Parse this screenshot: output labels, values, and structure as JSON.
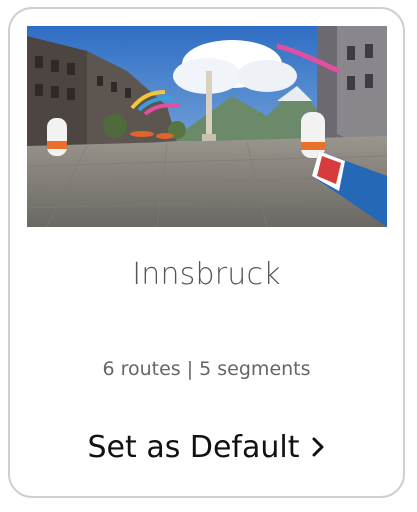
{
  "card": {
    "title": "Innsbruck",
    "stats": "6 routes | 5 segments",
    "action_label": "Set as Default",
    "thumbnail_icon": "innsbruck-street-scene-image",
    "chevron_icon": "chevron-right-icon"
  },
  "colors": {
    "border": "#cfcfcf",
    "title": "#555555",
    "stats": "#666666",
    "action": "#111111"
  }
}
